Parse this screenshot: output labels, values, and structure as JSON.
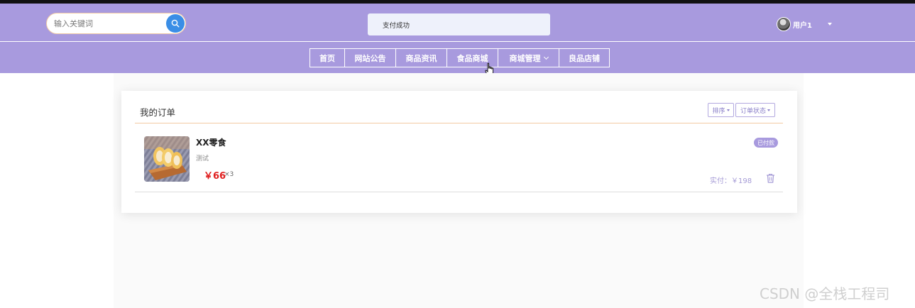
{
  "search": {
    "placeholder": "输入关键词"
  },
  "toast": {
    "message": "支付成功"
  },
  "user": {
    "name": "用户1"
  },
  "nav": {
    "items": [
      "首页",
      "网站公告",
      "商品资讯",
      "食品商城",
      "商城管理",
      "良品店铺"
    ]
  },
  "orders": {
    "title": "我的订单",
    "sort_label": "排序",
    "status_label": "订单状态",
    "items": [
      {
        "name": "XX零食",
        "desc": "测试",
        "price": "￥66",
        "qty": "×3",
        "status": "已付款",
        "paid": "实付：￥198"
      }
    ]
  },
  "watermark": "CSDN @全栈工程司",
  "colors": {
    "header": "#a89ade",
    "accent": "#3a8ee6",
    "price": "#e02020",
    "divider": "#f3c9a2"
  }
}
